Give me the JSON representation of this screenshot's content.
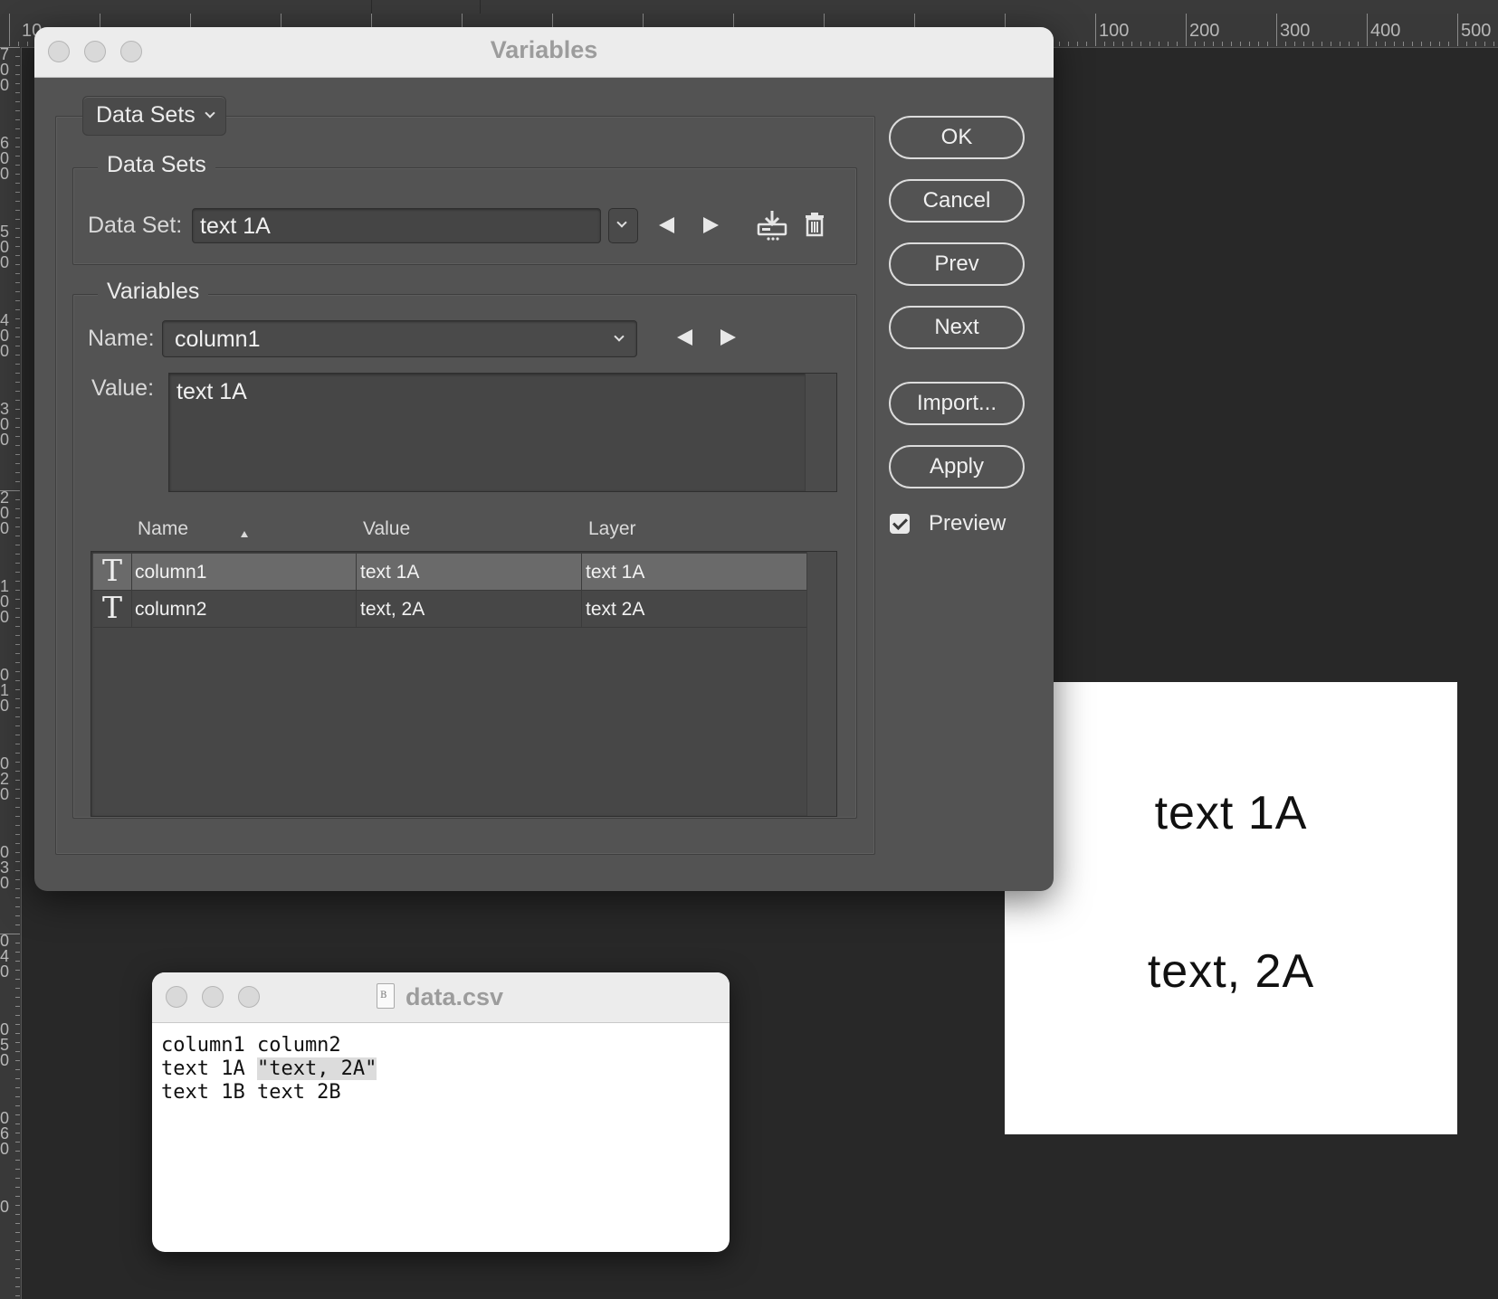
{
  "ruler": {
    "top_numbers": [
      "100",
      "200",
      "300",
      "400",
      "500"
    ],
    "top_left_partial": "10",
    "left_digits": [
      "7",
      "0",
      "0",
      "6",
      "0",
      "0",
      "5",
      "0",
      "0",
      "4",
      "0",
      "0",
      "3",
      "0",
      "0",
      "2",
      "0",
      "0",
      "1",
      "0",
      "0",
      "0",
      "1",
      "0",
      "0",
      "2",
      "0",
      "0",
      "3",
      "0",
      "0",
      "4",
      "0",
      "0",
      "5",
      "0",
      "0",
      "6",
      "0",
      "0"
    ]
  },
  "canvas": {
    "line1": "text 1A",
    "line2": "text, 2A"
  },
  "dialog": {
    "title": "Variables",
    "mode_popup": "Data Sets",
    "datasets_group": {
      "title": "Data Sets",
      "label": "Data Set:",
      "value": "text 1A"
    },
    "variables_group": {
      "title": "Variables",
      "name_label": "Name:",
      "name_value": "column1",
      "value_label": "Value:",
      "value_text": "text 1A",
      "table": {
        "headers": [
          "Name",
          "Value",
          "Layer"
        ],
        "rows": [
          {
            "icon": "text-layer-icon",
            "glyph": "T",
            "name": "column1",
            "value": "text 1A",
            "layer": "text 1A",
            "selected": true
          },
          {
            "icon": "text-layer-icon",
            "glyph": "T",
            "name": "column2",
            "value": "text, 2A",
            "layer": "text 2A",
            "selected": false
          }
        ]
      }
    },
    "buttons": {
      "ok": "OK",
      "cancel": "Cancel",
      "prev": "Prev",
      "next": "Next",
      "import": "Import...",
      "apply": "Apply"
    },
    "preview": {
      "label": "Preview",
      "checked": true
    }
  },
  "csv_window": {
    "title": "data.csv",
    "lines": [
      {
        "before": "column1 column2",
        "highlight": "",
        "after": ""
      },
      {
        "before": "text 1A ",
        "highlight": "\"text, 2A\"",
        "after": ""
      },
      {
        "before": "text 1B text 2B",
        "highlight": "",
        "after": ""
      }
    ]
  }
}
